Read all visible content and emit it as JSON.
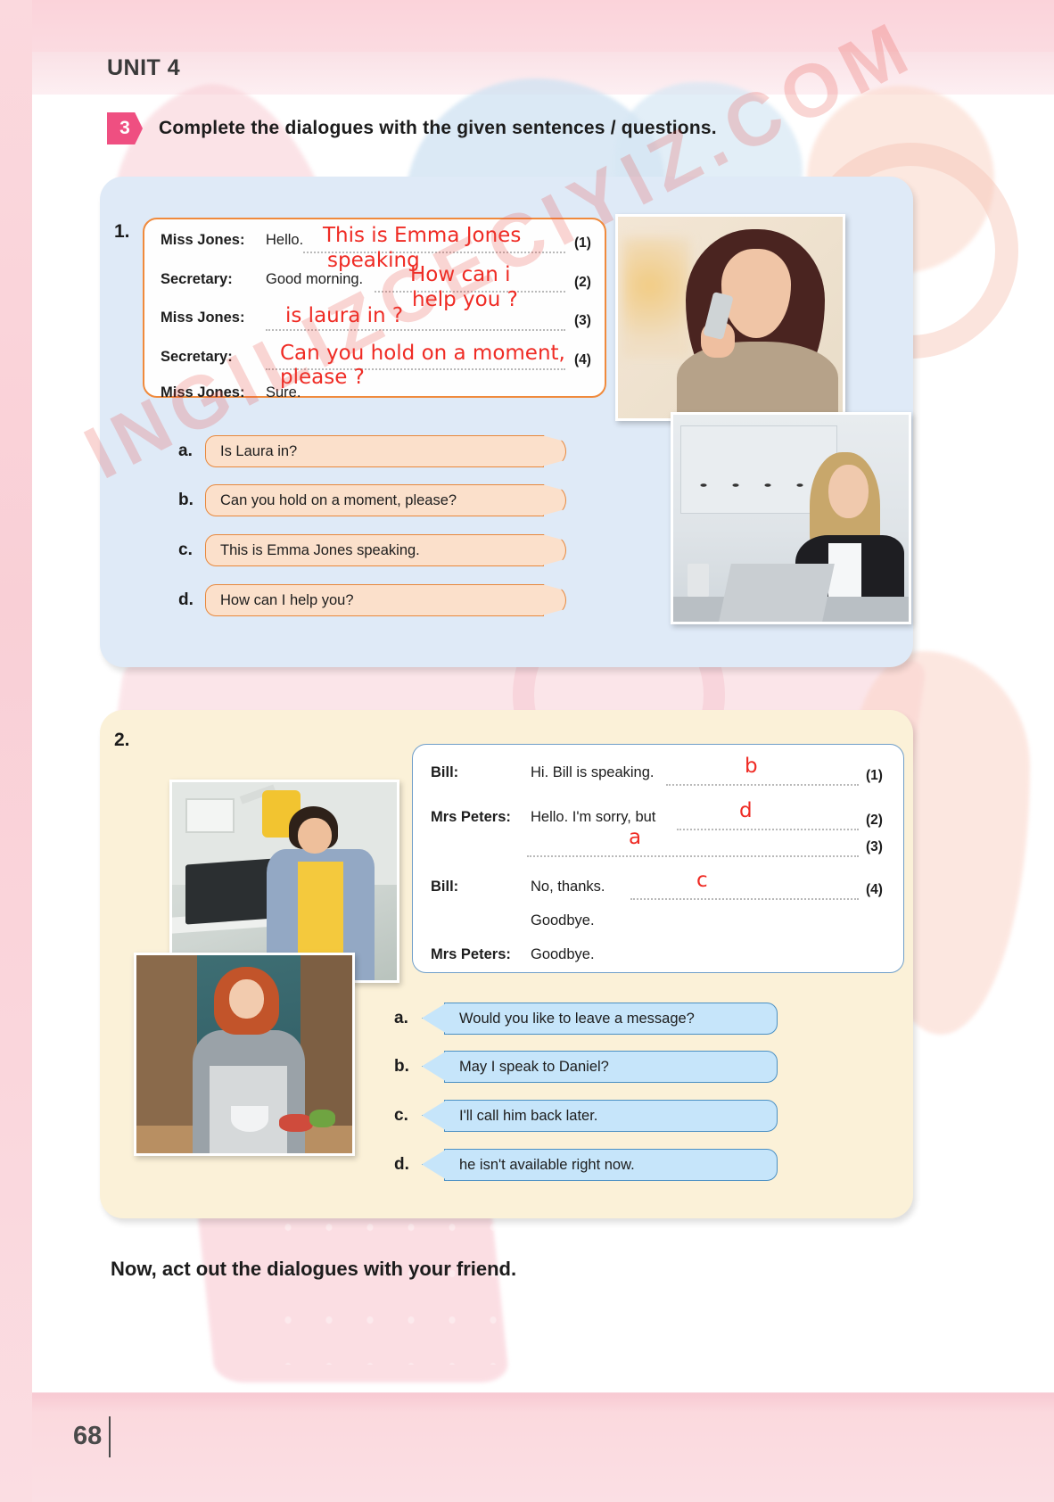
{
  "header": {
    "unit": "UNIT 4",
    "task_number": "3",
    "task_instruction": "Complete the dialogues with the given sentences / questions."
  },
  "colors": {
    "task_badge": "#ef4f81",
    "panel1_bg": "#dfeaf7",
    "panel2_bg": "#fbf1d8",
    "orange_bubble": "#fbe0cb",
    "orange_border": "#e8883c",
    "blue_bubble": "#c6e5fa",
    "blue_border": "#4a90c4",
    "handwriting": "#ef2b24",
    "watermark": "#e8473f"
  },
  "watermark": {
    "text": "INGILIZCECIYIZ.COM"
  },
  "exercise1": {
    "number": "1.",
    "dialogue": [
      {
        "speaker": "Miss Jones:",
        "text": "Hello.",
        "index": "(1)",
        "answer": "This is Emma Jones speaking"
      },
      {
        "speaker": "Secretary:",
        "text": "Good morning.",
        "index": "(2)",
        "answer": "How can i help you ?"
      },
      {
        "speaker": "Miss Jones:",
        "text": "",
        "index": "(3)",
        "answer": "is laura in ?"
      },
      {
        "speaker": "Secretary:",
        "text": "",
        "index": "(4)",
        "answer": "Can you hold on a moment, please ?"
      },
      {
        "speaker": "Miss Jones:",
        "text": "Sure.",
        "index": "",
        "answer": ""
      }
    ],
    "handwritten": {
      "line1a": "This is Emma Jones",
      "line1b": "speaking",
      "line2a": "How can i",
      "line2b": "help you ?",
      "line3": "is laura in ?",
      "line4a": "Can you hold on a moment,",
      "line4b": "please ?"
    },
    "options": [
      {
        "letter": "a.",
        "text": "Is Laura in?"
      },
      {
        "letter": "b.",
        "text": "Can you hold on a moment, please?"
      },
      {
        "letter": "c.",
        "text": "This is Emma Jones speaking."
      },
      {
        "letter": "d.",
        "text": "How can I help you?"
      }
    ],
    "photos": [
      {
        "name": "woman-on-phone-photo"
      },
      {
        "name": "secretary-on-phone-photo"
      }
    ]
  },
  "exercise2": {
    "number": "2.",
    "dialogue": [
      {
        "speaker": "Bill:",
        "text": "Hi. Bill is speaking.",
        "index": "(1)",
        "answer": "b"
      },
      {
        "speaker": "Mrs Peters:",
        "text": "Hello. I'm sorry, but",
        "index": "(2)",
        "answer": "d"
      },
      {
        "speaker": "",
        "text": "",
        "index": "(3)",
        "answer": "a"
      },
      {
        "speaker": "Bill:",
        "text": "No, thanks.",
        "index": "(4)",
        "answer": "c"
      },
      {
        "speaker": "",
        "text": "Goodbye.",
        "index": "",
        "answer": ""
      },
      {
        "speaker": "Mrs Peters:",
        "text": "Goodbye.",
        "index": "",
        "answer": ""
      }
    ],
    "options": [
      {
        "letter": "a.",
        "text": "Would you like to leave a message?"
      },
      {
        "letter": "b.",
        "text": "May I speak to Daniel?"
      },
      {
        "letter": "c.",
        "text": "I'll call him back later."
      },
      {
        "letter": "d.",
        "text": "he isn't available right now."
      }
    ],
    "photos": [
      {
        "name": "boy-on-phone-photo"
      },
      {
        "name": "woman-kitchen-phone-photo"
      }
    ]
  },
  "footer": {
    "closing_text": "Now, act out the dialogues with your friend.",
    "page_number": "68"
  }
}
